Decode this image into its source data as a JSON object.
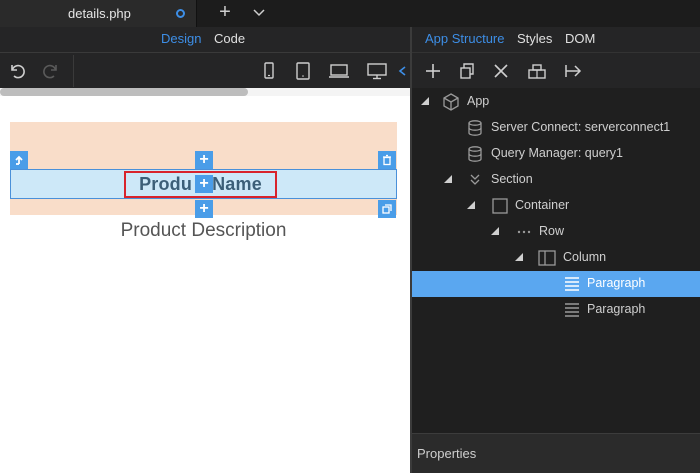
{
  "tabs": [
    {
      "title": "details.php",
      "modified": true
    }
  ],
  "tab_add_label": "+",
  "editor_modes": {
    "design": "Design",
    "code": "Code",
    "active": "design"
  },
  "panel_tabs": {
    "app_structure": "App Structure",
    "styles": "Styles",
    "dom": "DOM",
    "active": "app_structure"
  },
  "canvas": {
    "product_name": "Produ",
    "product_name_tail": "Name",
    "product_description": "Product Description"
  },
  "tree": [
    {
      "label": "App",
      "icon": "cube-icon",
      "expanded": true
    },
    {
      "label": "Server Connect: serverconnect1",
      "icon": "database-icon"
    },
    {
      "label": "Query Manager: query1",
      "icon": "database-icon"
    },
    {
      "label": "Section",
      "icon": "chevrons-down-icon",
      "expanded": true
    },
    {
      "label": "Container",
      "icon": "square-icon",
      "expanded": true
    },
    {
      "label": "Row",
      "icon": "dots-icon",
      "expanded": true
    },
    {
      "label": "Column",
      "icon": "column-icon",
      "expanded": true
    },
    {
      "label": "Paragraph",
      "icon": "paragraph-icon",
      "selected": true
    },
    {
      "label": "Paragraph",
      "icon": "paragraph-icon"
    }
  ],
  "properties_label": "Properties",
  "colors": {
    "accent": "#3d8ee6",
    "selection": "#5aa7f0",
    "highlight_border": "#d8242c",
    "peach": "#f9ddc9",
    "light_blue": "#cde8f8"
  }
}
